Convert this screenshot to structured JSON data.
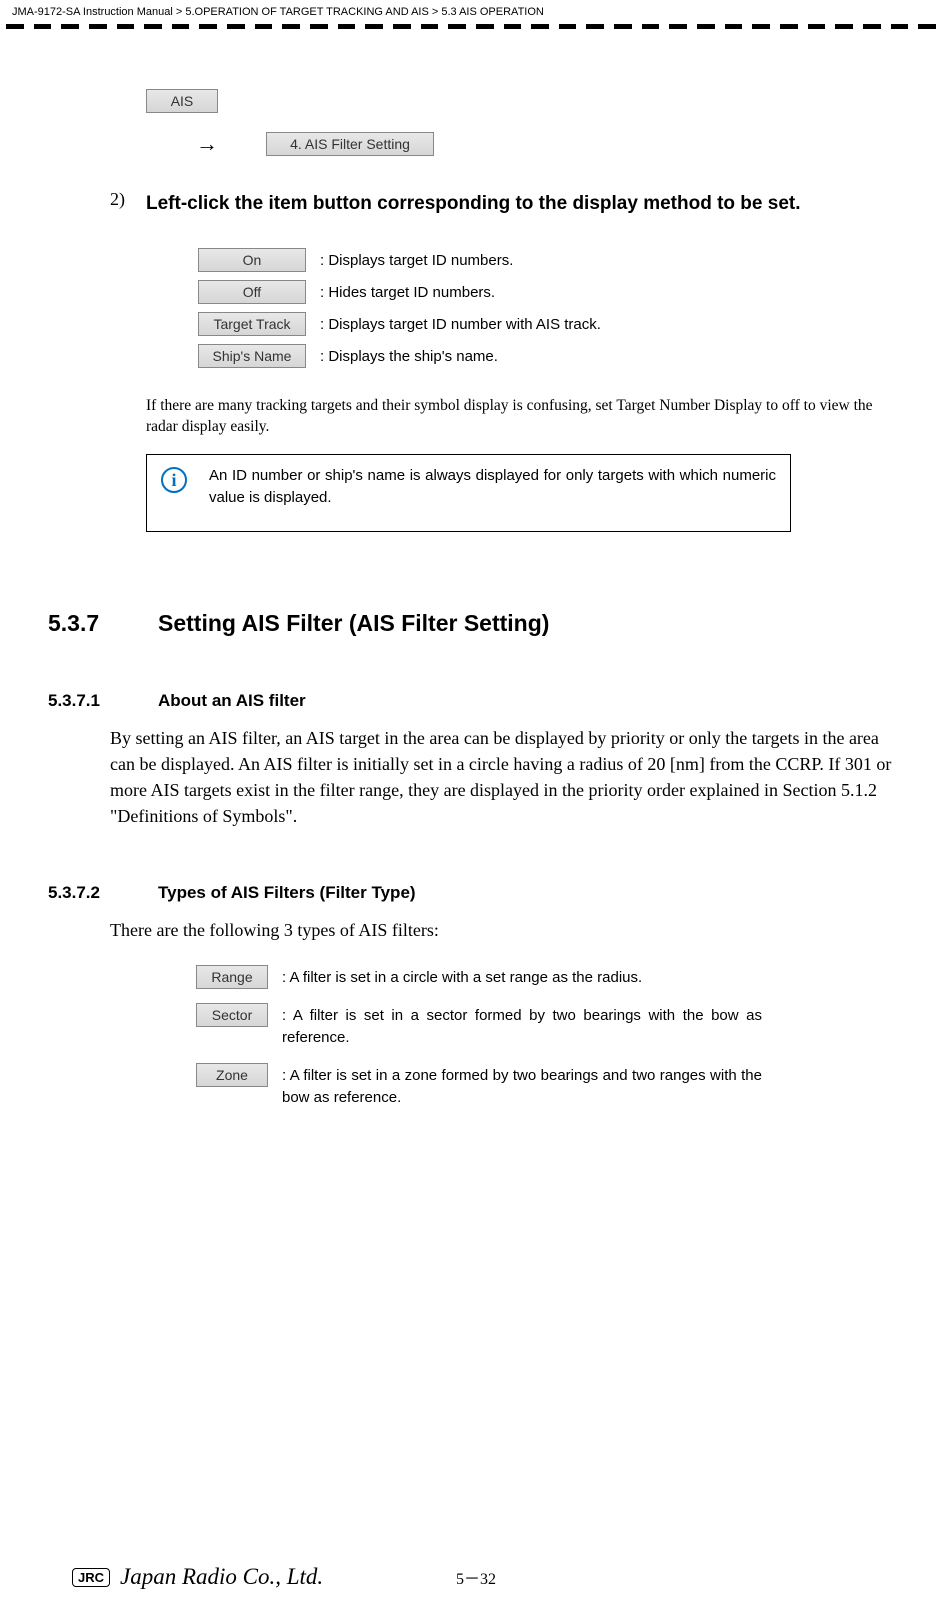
{
  "header": {
    "breadcrumb": "JMA-9172-SA Instruction Manual > 5.OPERATION OF TARGET TRACKING AND AIS > 5.3  AIS OPERATION"
  },
  "top_buttons": {
    "ais": "AIS",
    "arrow": "→",
    "filter_setting": "4. AIS Filter Setting"
  },
  "step": {
    "num": "2)",
    "text": "Left-click the item button corresponding to the display method to be set."
  },
  "options": {
    "on": {
      "label": "On",
      "desc": ": Displays target ID numbers."
    },
    "off": {
      "label": "Off",
      "desc": ": Hides target ID numbers."
    },
    "track": {
      "label": "Target Track",
      "desc": ": Displays target ID number with AIS track."
    },
    "name": {
      "label": "Ship's Name",
      "desc": ": Displays the ship's name."
    }
  },
  "note": "If there are many tracking targets and their symbol display is confusing, set Target Number Display to off to view the radar display easily.",
  "info": {
    "icon": "i",
    "text": "An ID number or ship's name is always displayed for only targets with which numeric value is displayed."
  },
  "section537": {
    "num": "5.3.7",
    "title": "Setting AIS Filter (AIS Filter Setting)"
  },
  "section5371": {
    "num": "5.3.7.1",
    "title": "About an AIS filter",
    "para": "By setting an AIS filter, an AIS target in the area can be displayed by priority or only the targets in the area can be displayed. An AIS filter is initially set in a circle having a radius of 20 [nm] from the CCRP. If 301 or more AIS targets exist in the filter range, they are displayed in the priority order explained in Section 5.1.2 \"Definitions of Symbols\"."
  },
  "section5372": {
    "num": "5.3.7.2",
    "title": "Types of AIS Filters (Filter Type)",
    "para": "There are the following 3 types of AIS filters:"
  },
  "filters": {
    "range": {
      "label": "Range",
      "desc": ": A filter is set in a circle with a set range as the radius."
    },
    "sector": {
      "label": "Sector",
      "desc": ": A filter is set in a sector formed by two bearings with the bow as reference."
    },
    "zone": {
      "label": "Zone",
      "desc": ": A filter is set in a zone formed by two bearings and two ranges with the bow as reference."
    }
  },
  "footer": {
    "jrc": "JRC",
    "company": "Japan Radio Co., Ltd.",
    "page": "5－32"
  }
}
